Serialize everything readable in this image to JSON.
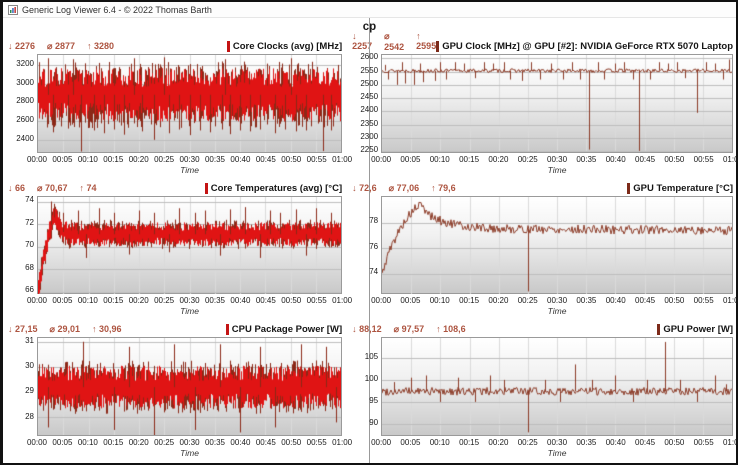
{
  "window": {
    "title": "Generic Log Viewer 6.4 - © 2022 Thomas Barth"
  },
  "header": {
    "label": "cp"
  },
  "stat_icons": {
    "min": "↓",
    "avg": "⌀",
    "max": "↑"
  },
  "colors": {
    "stats_text": "#ad5440",
    "left_series": "#e01414",
    "left_shadow": "#8b2817",
    "right_series": "#8b3a26",
    "grid_line": "#bdbdbd",
    "grid_line_vertical": "#dadada",
    "plot_border": "#9a9a9a",
    "splitter": "#999999"
  },
  "time_axis": {
    "label": "Time",
    "ticks": [
      "00:00",
      "00:05",
      "00:10",
      "00:15",
      "00:20",
      "00:25",
      "00:30",
      "00:35",
      "00:40",
      "00:45",
      "00:50",
      "00:55",
      "01:00"
    ]
  },
  "chart_data": [
    {
      "type": "line",
      "style": "band",
      "title": "Core Clocks (avg) [MHz]",
      "stats": {
        "min": "2276",
        "avg": "2877",
        "max": "3280"
      },
      "accent": "#c41414",
      "series_color": "#e01414",
      "shadow_color": "#8b2817",
      "xlabel": "Time",
      "xlim_minutes": [
        0,
        60
      ],
      "ylim": [
        2270,
        3305
      ],
      "yticks": [
        2400,
        2600,
        2800,
        3000,
        3200
      ],
      "trend": [
        [
          0,
          2880
        ],
        [
          60,
          2880
        ]
      ],
      "noise_amp": 285,
      "spikes": [
        [
          2,
          3270
        ],
        [
          3,
          2480
        ],
        [
          6,
          2520
        ],
        [
          7,
          3260
        ],
        [
          8.5,
          2276
        ],
        [
          11,
          2500
        ],
        [
          13,
          2470
        ],
        [
          15,
          2510
        ],
        [
          17,
          2455
        ],
        [
          19,
          3270
        ],
        [
          20.5,
          2490
        ],
        [
          23,
          2400
        ],
        [
          25,
          3280
        ],
        [
          26,
          2470
        ],
        [
          28,
          2510
        ],
        [
          30,
          2450
        ],
        [
          32,
          2500
        ],
        [
          34,
          2480
        ],
        [
          36.5,
          2510
        ],
        [
          37,
          3260
        ],
        [
          38,
          2460
        ],
        [
          40,
          2500
        ],
        [
          42,
          2490
        ],
        [
          44,
          2510
        ],
        [
          47,
          2470
        ],
        [
          49,
          2510
        ],
        [
          50,
          3270
        ],
        [
          51,
          2490
        ],
        [
          53,
          2500
        ],
        [
          56.5,
          2280
        ],
        [
          58,
          2500
        ]
      ],
      "seed": 7
    },
    {
      "type": "line",
      "style": "line",
      "title": "GPU Clock [MHz] @ GPU [#2]: NVIDIA GeForce RTX 5070 Laptop",
      "stats": {
        "min": "2257",
        "avg": "2542",
        "max": "2595"
      },
      "accent": "#7d2b1a",
      "series_color": "#8b3a26",
      "xlabel": "Time",
      "xlim_minutes": [
        0,
        60
      ],
      "ylim": [
        2248,
        2612
      ],
      "yticks": [
        2250,
        2300,
        2350,
        2400,
        2450,
        2500,
        2550,
        2600
      ],
      "trend": [
        [
          0,
          2553
        ],
        [
          60,
          2553
        ]
      ],
      "noise_amp": 7,
      "spikes": [
        [
          0.5,
          2575
        ],
        [
          1,
          2520
        ],
        [
          2.5,
          2500
        ],
        [
          3.5,
          2585
        ],
        [
          4,
          2505
        ],
        [
          5.5,
          2500
        ],
        [
          6.5,
          2580
        ],
        [
          7,
          2510
        ],
        [
          9,
          2515
        ],
        [
          10,
          2585
        ],
        [
          11,
          2520
        ],
        [
          12.5,
          2585
        ],
        [
          14,
          2580
        ],
        [
          16,
          2525
        ],
        [
          17.5,
          2585
        ],
        [
          19,
          2580
        ],
        [
          21,
          2585
        ],
        [
          22,
          2520
        ],
        [
          24,
          2515
        ],
        [
          25.5,
          2585
        ],
        [
          27,
          2520
        ],
        [
          29,
          2580
        ],
        [
          31,
          2520
        ],
        [
          32.5,
          2585
        ],
        [
          34,
          2520
        ],
        [
          35.5,
          2257
        ],
        [
          37,
          2585
        ],
        [
          38,
          2520
        ],
        [
          40,
          2580
        ],
        [
          41.5,
          2585
        ],
        [
          43,
          2520
        ],
        [
          44,
          2252
        ],
        [
          46,
          2520
        ],
        [
          47.5,
          2585
        ],
        [
          49,
          2580
        ],
        [
          50.5,
          2585
        ],
        [
          52,
          2525
        ],
        [
          54,
          2395
        ],
        [
          55.5,
          2585
        ],
        [
          57,
          2580
        ],
        [
          58.5,
          2520
        ],
        [
          59.5,
          2595
        ]
      ],
      "seed": 13
    },
    {
      "type": "line",
      "style": "band",
      "title": "Core Temperatures (avg) [°C]",
      "stats": {
        "min": "66",
        "avg": "70,67",
        "max": "74"
      },
      "accent": "#c41414",
      "series_color": "#e01414",
      "shadow_color": "#8b2817",
      "xlabel": "Time",
      "xlim_minutes": [
        0,
        60
      ],
      "ylim": [
        65.8,
        74.4
      ],
      "yticks": [
        66,
        68,
        70,
        72,
        74
      ],
      "trend": [
        [
          0,
          66.2
        ],
        [
          0.8,
          68.5
        ],
        [
          1.8,
          70.5
        ],
        [
          2.8,
          72.3
        ],
        [
          3.5,
          72.8
        ],
        [
          4.5,
          71.4
        ],
        [
          6,
          71.1
        ],
        [
          60,
          71.1
        ]
      ],
      "noise_amp": 1.05,
      "spikes": [
        [
          2.6,
          74
        ],
        [
          3.2,
          73.8
        ],
        [
          5,
          73
        ],
        [
          8,
          73.2
        ],
        [
          9.5,
          69
        ],
        [
          12,
          73.4
        ],
        [
          15,
          73
        ],
        [
          18,
          69.3
        ],
        [
          20,
          73.2
        ],
        [
          23,
          73
        ],
        [
          26,
          69.5
        ],
        [
          28,
          73.4
        ],
        [
          31,
          73
        ],
        [
          33,
          73.2
        ],
        [
          36,
          69.2
        ],
        [
          38,
          73.3
        ],
        [
          41,
          73.5
        ],
        [
          44,
          69
        ],
        [
          46,
          73.2
        ],
        [
          48,
          73
        ],
        [
          51,
          73.3
        ],
        [
          53,
          69.2
        ],
        [
          55,
          73.4
        ],
        [
          58,
          73
        ]
      ],
      "seed": 21
    },
    {
      "type": "line",
      "style": "line",
      "title": "GPU Temperature [°C]",
      "stats": {
        "min": "72,6",
        "avg": "77,06",
        "max": "79,6"
      },
      "accent": "#7d2b1a",
      "series_color": "#8b3a26",
      "xlabel": "Time",
      "xlim_minutes": [
        0,
        60
      ],
      "ylim": [
        72.4,
        80
      ],
      "yticks": [
        74,
        76,
        78
      ],
      "trend": [
        [
          0,
          73.9
        ],
        [
          1,
          75.5
        ],
        [
          2.5,
          77
        ],
        [
          4,
          78.2
        ],
        [
          5.5,
          79
        ],
        [
          6.5,
          79.4
        ],
        [
          7.5,
          78.9
        ],
        [
          9,
          78.3
        ],
        [
          11,
          78
        ],
        [
          14,
          77.7
        ],
        [
          20,
          77.5
        ],
        [
          60,
          77.4
        ]
      ],
      "noise_amp": 0.35,
      "spikes": [
        [
          25,
          72.6
        ]
      ],
      "seed": 5
    },
    {
      "type": "line",
      "style": "band",
      "title": "CPU Package Power [W]",
      "stats": {
        "min": "27,15",
        "avg": "29,01",
        "max": "30,96"
      },
      "accent": "#c41414",
      "series_color": "#e01414",
      "shadow_color": "#8b2817",
      "xlabel": "Time",
      "xlim_minutes": [
        0,
        60
      ],
      "ylim": [
        27.3,
        31.15
      ],
      "yticks": [
        28,
        29,
        30,
        31
      ],
      "trend": [
        [
          0,
          29.2
        ],
        [
          60,
          29.2
        ]
      ],
      "noise_amp": 0.85,
      "spikes": [
        [
          2,
          27.6
        ],
        [
          9,
          31
        ],
        [
          15,
          27.5
        ],
        [
          18,
          30.8
        ],
        [
          23,
          27.2
        ],
        [
          27,
          30.9
        ],
        [
          31,
          27.5
        ],
        [
          36,
          30.9
        ],
        [
          40,
          27.4
        ],
        [
          44,
          30.8
        ],
        [
          47,
          27.6
        ],
        [
          52,
          30.9
        ],
        [
          57,
          30.8
        ],
        [
          59,
          27.8
        ]
      ],
      "seed": 42
    },
    {
      "type": "line",
      "style": "line",
      "title": "GPU Power [W]",
      "stats": {
        "min": "88,12",
        "avg": "97,57",
        "max": "108,6"
      },
      "accent": "#7d2b1a",
      "series_color": "#8b3a26",
      "xlabel": "Time",
      "xlim_minutes": [
        0,
        60
      ],
      "ylim": [
        87.5,
        109.5
      ],
      "yticks": [
        90,
        95,
        100,
        105
      ],
      "trend": [
        [
          0,
          97.4
        ],
        [
          60,
          97.4
        ]
      ],
      "noise_amp": 0.9,
      "spikes": [
        [
          2,
          99.5
        ],
        [
          5,
          100.5
        ],
        [
          7.5,
          101
        ],
        [
          10,
          95
        ],
        [
          13,
          100.5
        ],
        [
          16,
          95
        ],
        [
          18.5,
          101
        ],
        [
          21,
          100
        ],
        [
          25,
          88.1
        ],
        [
          28,
          100
        ],
        [
          30.5,
          95
        ],
        [
          33,
          103.5
        ],
        [
          36,
          100
        ],
        [
          40,
          101
        ],
        [
          43,
          95
        ],
        [
          45.5,
          100
        ],
        [
          48.5,
          108.6
        ],
        [
          51,
          100
        ],
        [
          54,
          95
        ],
        [
          57,
          101
        ],
        [
          59,
          99
        ]
      ],
      "seed": 99
    }
  ]
}
